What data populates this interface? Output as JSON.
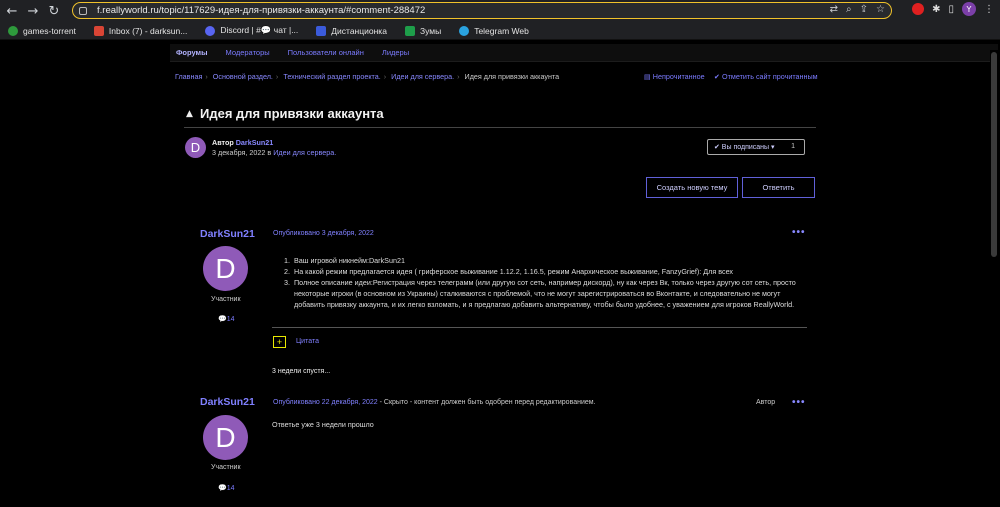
{
  "browser": {
    "url": "f.reallyworld.ru/topic/117629-идея-для-привязки-аккаунта/#comment-288472",
    "profile_initial": "Y",
    "bookmarks": [
      {
        "label": "games-torrent",
        "color": "#2e9a3c"
      },
      {
        "label": "Inbox (7) - darksun...",
        "color": "#d94535"
      },
      {
        "label": "Discord | #💬 чат |...",
        "color": "#5865f2"
      },
      {
        "label": "Дистанционка",
        "color": "#3b5bdb"
      },
      {
        "label": "Зумы",
        "color": "#1e9e4a"
      },
      {
        "label": "Telegram Web",
        "color": "#2aa3e0"
      }
    ]
  },
  "nav": {
    "items": [
      "Форумы",
      "Модераторы",
      "Пользователи онлайн",
      "Лидеры"
    ]
  },
  "breadcrumb": {
    "items": [
      "Главная",
      "Основной раздел.",
      "Технический раздел проекта.",
      "Идеи для сервера.",
      "Идея для привязки аккаунта"
    ],
    "unread": "Непрочитанное",
    "mark_all": "Отметить сайт прочитанным"
  },
  "topic": {
    "warn_icon": "▲",
    "title": "Идея для привязки аккаунта",
    "author_initial": "D",
    "author_prefix": "Автор",
    "author": "DarkSun21",
    "date": "3 декабря, 2022",
    "in": "в",
    "forum": "Идеи для сервера.",
    "subscribe_label": "✔ Вы подписаны ▾",
    "subscribe_count": "1",
    "new_topic": "Создать новую тему",
    "reply": "Ответить"
  },
  "posts": [
    {
      "author": "DarkSun21",
      "initial": "D",
      "role": "Участник",
      "count": "💬14",
      "posted": "Опубликовано 3 декабря, 2022",
      "dots": "•••",
      "items": [
        {
          "num": "1.",
          "text": "Ваш игровой никнейм:DarkSun21"
        },
        {
          "num": "2.",
          "text": "На какой режим предлагается идея ( гриферское выживание 1.12.2, 1.16.5, режим Анархическое выживание, FanzyGrief): Для всех"
        },
        {
          "num": "3.",
          "text": "Полное описание идеи:Регистрация через телеграмм (или другую сот сеть, например дискорд), ну как через Вк, только через другую сот сеть, просто некоторые игроки (в основном из Украины) сталкиваются с проблемой, что не могут зарегистрироваться во Вконтакте, и следовательно не могут добавить привязку аккаунта, и их легко взломать, и я предлагаю добавить альтернативу, чтобы было удобнее, с уважением для игроков ReallyWorld."
        }
      ],
      "quote": "Цитата"
    },
    {
      "author": "DarkSun21",
      "initial": "D",
      "role": "Участник",
      "count": "💬14",
      "posted": "Опубликовано 22 декабря, 2022",
      "hidden_note": " - Скрыто - контент должен быть одобрен перед редактированием.",
      "author_badge": "Автор",
      "dots": "•••",
      "body": "Ответье уже 3 недели прошло"
    }
  ],
  "time_gap": "3 недели спустя..."
}
